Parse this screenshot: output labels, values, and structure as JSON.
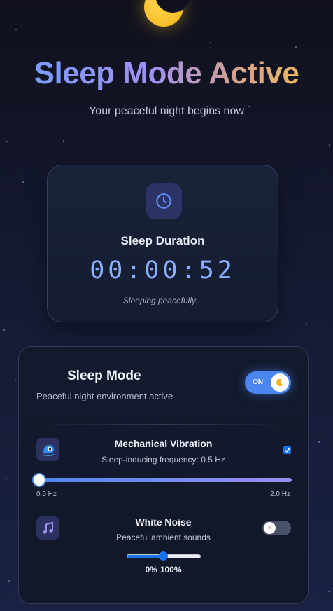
{
  "header": {
    "title": "Sleep Mode Active",
    "subtitle": "Your peaceful night begins now"
  },
  "timer": {
    "label": "Sleep Duration",
    "value": "00:00:52",
    "status": "Sleeping peacefully..."
  },
  "sleep_mode": {
    "title": "Sleep Mode",
    "description": "Peaceful night environment active",
    "toggle_label": "ON",
    "enabled": true
  },
  "vibration": {
    "title": "Mechanical Vibration",
    "subtitle": "Sleep-inducing frequency: 0.5 Hz",
    "enabled": true,
    "min_label": "0.5 Hz",
    "max_label": "2.0 Hz",
    "value_fraction": 0
  },
  "white_noise": {
    "title": "White Noise",
    "subtitle": "Peaceful ambient sounds",
    "enabled": false,
    "volume_min_label": "0%",
    "volume_max_label": "100%",
    "volume_fraction": 0.5
  },
  "colors": {
    "accent": "#4c86f0",
    "moon": "#f4b418",
    "timer_digits": "#8ab0ff"
  },
  "icons": {
    "moon": "crescent-moon-icon",
    "clock": "clock-icon",
    "vibration": "vibration-icon",
    "noise": "music-note-icon"
  }
}
